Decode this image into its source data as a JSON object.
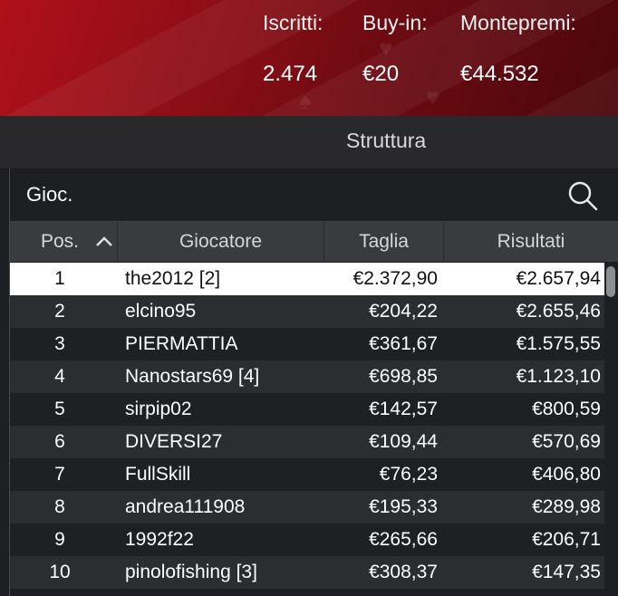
{
  "stats": [
    {
      "label": "Iscritti:",
      "value": "2.474"
    },
    {
      "label": "Buy-in:",
      "value": "€20"
    },
    {
      "label": "Montepremi:",
      "value": "€44.532"
    }
  ],
  "tabs": {
    "structure": "Struttura"
  },
  "search": {
    "label": "Gioc.",
    "icon": "search-icon"
  },
  "table": {
    "headers": {
      "pos": "Pos.",
      "player": "Giocatore",
      "taglia": "Taglia",
      "risultati": "Risultati"
    },
    "sort_icon": "chevron-up-icon",
    "rows": [
      {
        "pos": "1",
        "player": "the2012 [2]",
        "taglia": "€2.372,90",
        "risultati": "€2.657,94"
      },
      {
        "pos": "2",
        "player": "elcino95",
        "taglia": "€204,22",
        "risultati": "€2.655,46"
      },
      {
        "pos": "3",
        "player": "PIERMATTIA",
        "taglia": "€361,67",
        "risultati": "€1.575,55"
      },
      {
        "pos": "4",
        "player": "Nanostars69 [4]",
        "taglia": "€698,85",
        "risultati": "€1.123,10"
      },
      {
        "pos": "5",
        "player": "sirpip02",
        "taglia": "€142,57",
        "risultati": "€800,59"
      },
      {
        "pos": "6",
        "player": "DIVERSI27",
        "taglia": "€109,44",
        "risultati": "€570,69"
      },
      {
        "pos": "7",
        "player": "FullSkill",
        "taglia": "€76,23",
        "risultati": "€406,80"
      },
      {
        "pos": "8",
        "player": "andrea111908",
        "taglia": "€195,33",
        "risultati": "€289,98"
      },
      {
        "pos": "9",
        "player": "1992f22",
        "taglia": "€265,66",
        "risultati": "€206,71"
      },
      {
        "pos": "10",
        "player": "pinolofishing [3]",
        "taglia": "€308,37",
        "risultati": "€147,35"
      }
    ]
  }
}
